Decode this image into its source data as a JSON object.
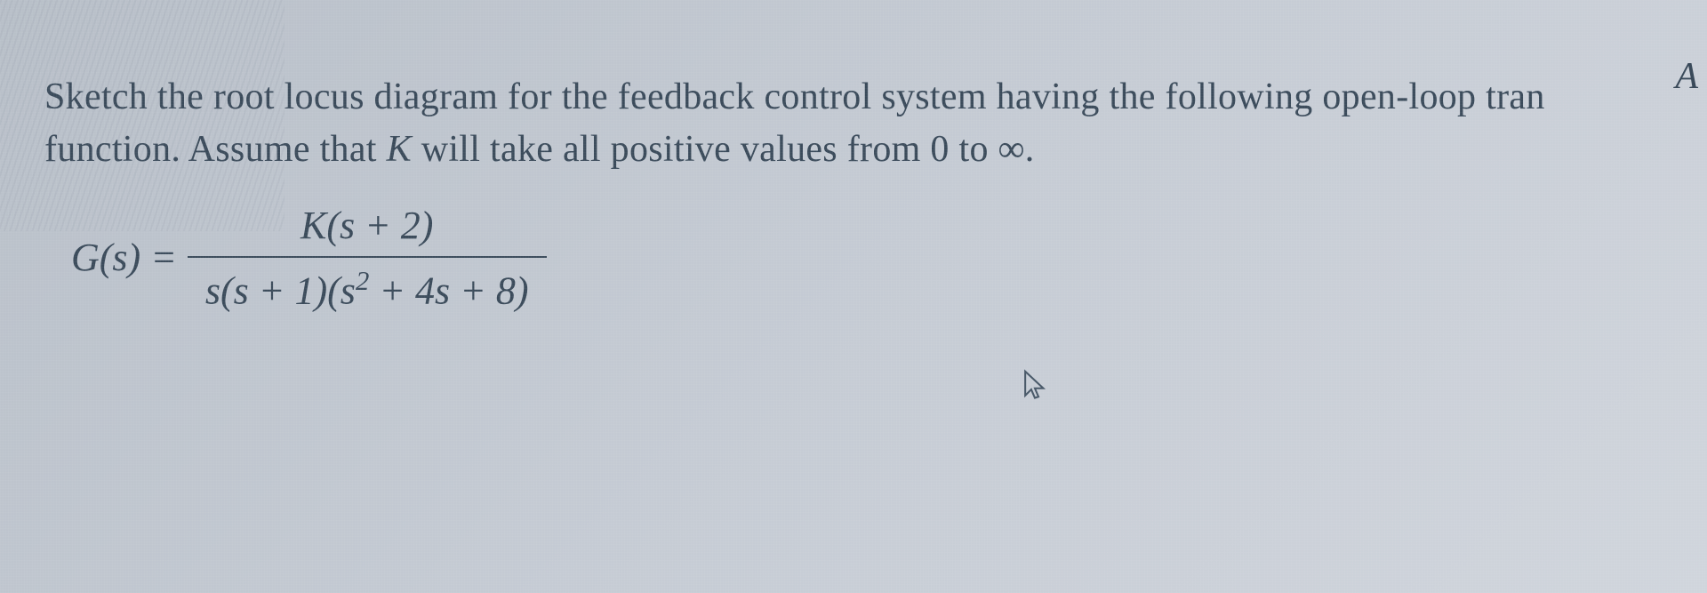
{
  "problem": {
    "line1_part1": "Sketch the root locus diagram for the feedback control system having the following open-loop tran",
    "line2_part1": "function. Assume that ",
    "line2_var": "K",
    "line2_part2": " will take all positive values from 0 to ∞.",
    "equation_lhs": "G(s) =",
    "numerator": "K(s + 2)",
    "denominator_part1": "s(s + 1)(s",
    "denominator_exp": "2",
    "denominator_part2": " + 4s + 8)"
  },
  "topRightMark": "A",
  "cursor": "mouse-pointer"
}
